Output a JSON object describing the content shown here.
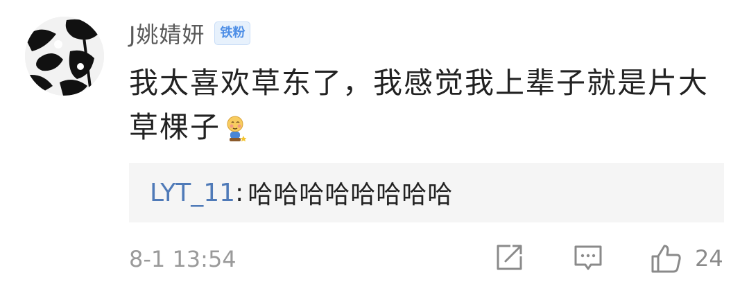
{
  "comment": {
    "username": "J姚婧妍",
    "badge": "铁粉",
    "text": "我太喜欢草东了，我感觉我上辈子就是片大草棵子",
    "emoji_icon": "shy-kid-emoji-icon",
    "reply": {
      "author": "LYT_11",
      "separator": ":",
      "text": "哈哈哈哈哈哈哈哈"
    },
    "timestamp": "8-1 13:54",
    "like_count": "24"
  },
  "colors": {
    "link_blue": "#4f7ab8",
    "badge_blue": "#4d8ee6",
    "meta_gray": "#9a9a9a",
    "reply_bg": "#f5f5f5"
  }
}
